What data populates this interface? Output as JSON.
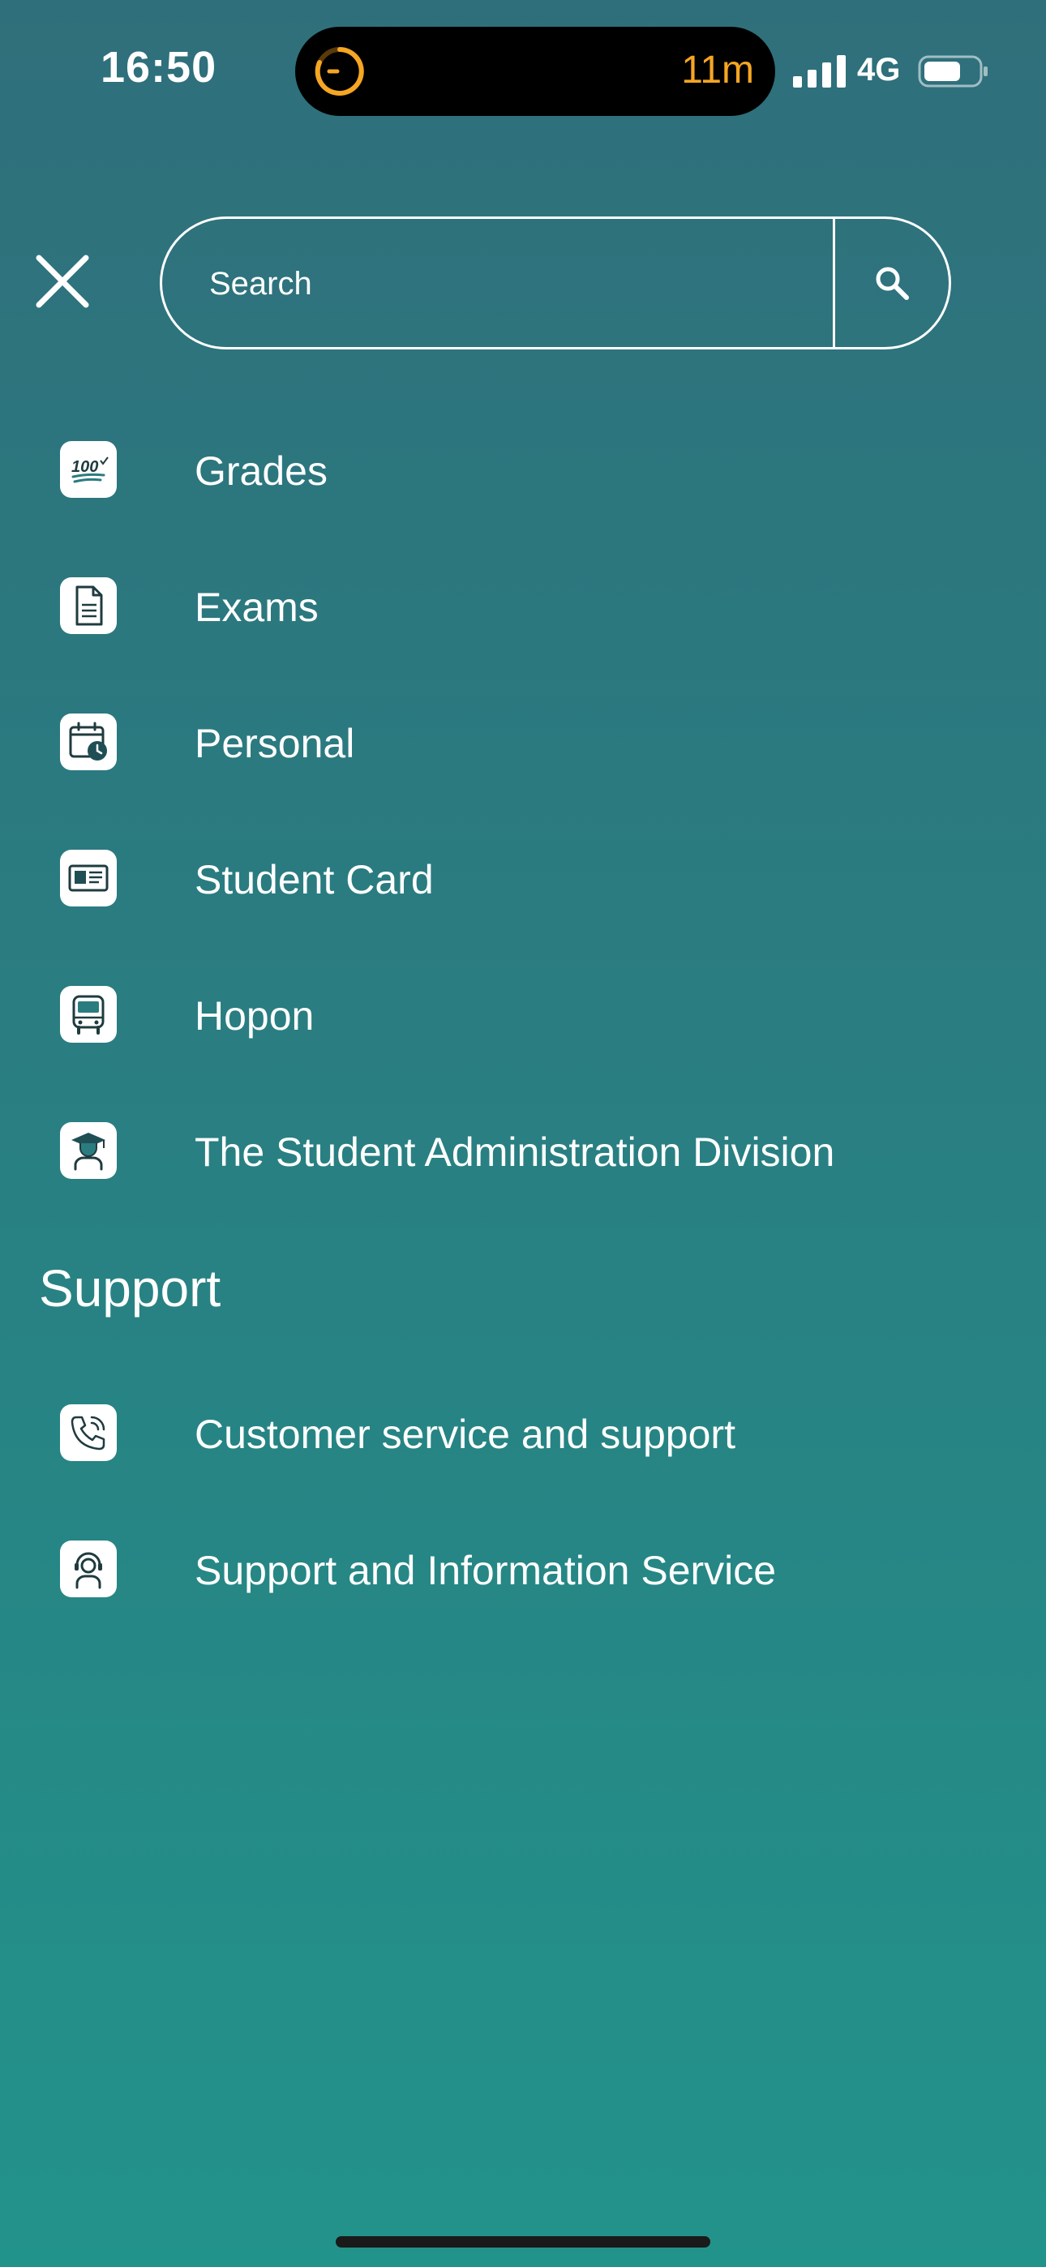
{
  "status_bar": {
    "time": "16:50",
    "island_text": "11m",
    "network": "4G",
    "icons": [
      "timer-icon",
      "signal-icon",
      "battery-icon"
    ]
  },
  "header": {
    "close_icon": "close-icon",
    "search": {
      "placeholder": "Search",
      "value": "",
      "button_icon": "search-icon"
    }
  },
  "menu": {
    "items": [
      {
        "label": "Grades",
        "icon": "grades-icon"
      },
      {
        "label": "Exams",
        "icon": "document-icon"
      },
      {
        "label": "Personal",
        "icon": "calendar-clock-icon"
      },
      {
        "label": "Student Card",
        "icon": "id-card-icon"
      },
      {
        "label": "Hopon",
        "icon": "bus-icon"
      },
      {
        "label": "The Student Administration Division",
        "icon": "graduate-icon"
      }
    ]
  },
  "support": {
    "heading": "Support",
    "items": [
      {
        "label": "Customer service and support",
        "icon": "phone-icon"
      },
      {
        "label": "Support and Information Service",
        "icon": "help-agent-icon"
      }
    ]
  },
  "colors": {
    "background_top": "#2f6f7b",
    "background_bottom": "#22938a",
    "icon_ink": "#1f3b3f",
    "accent_teal": "#2a7c80",
    "island_accent": "#f5a623"
  }
}
